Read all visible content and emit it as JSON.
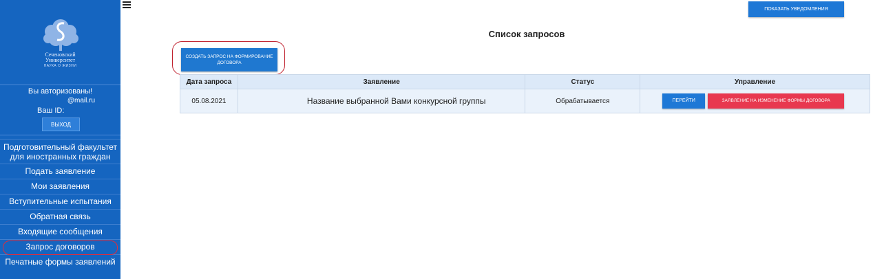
{
  "sidebar": {
    "logo_lines": [
      "Сеченовский",
      "Университет"
    ],
    "logo_sub": "НАУКА О ЖИЗНИ",
    "auth_text": "Вы авторизованы!",
    "email": "@mail.ru",
    "id_label": "Ваш ID:",
    "logout_label": "ВЫХОД",
    "menu": [
      {
        "label": "Подготовительный факультет для иностранных граждан"
      },
      {
        "label": "Подать заявление"
      },
      {
        "label": "Мои заявления"
      },
      {
        "label": "Вступительные испытания"
      },
      {
        "label": "Обратная связь"
      },
      {
        "label": "Входящие сообщения"
      },
      {
        "label": "Запрос договоров"
      },
      {
        "label": "Печатные формы заявлений"
      }
    ]
  },
  "header": {
    "notify_label": "ПОКАЗАТЬ УВЕДОМЛЕНИЯ"
  },
  "main": {
    "title": "Список запросов",
    "create_label": "СОЗДАТЬ ЗАПРОС НА ФОРМИРОВАНИЕ ДОГОВОРА",
    "columns": [
      "Дата запроса",
      "Заявление",
      "Статус",
      "Управление"
    ],
    "rows": [
      {
        "date": "05.08.2021",
        "application": "Название выбранной Вами конкурсной группы",
        "status": "Обрабатывается",
        "go_label": "ПЕРЕЙТИ",
        "change_label": "ЗАЯВЛЕНИЕ НА ИЗМЕНЕНИЕ ФОРМЫ ДОГОВОРА"
      }
    ]
  },
  "colors": {
    "sidebar_bg": "#1565c0",
    "primary_button": "#1e78d6",
    "danger_button": "#e8384f",
    "highlight_outline": "#e02c3c"
  }
}
